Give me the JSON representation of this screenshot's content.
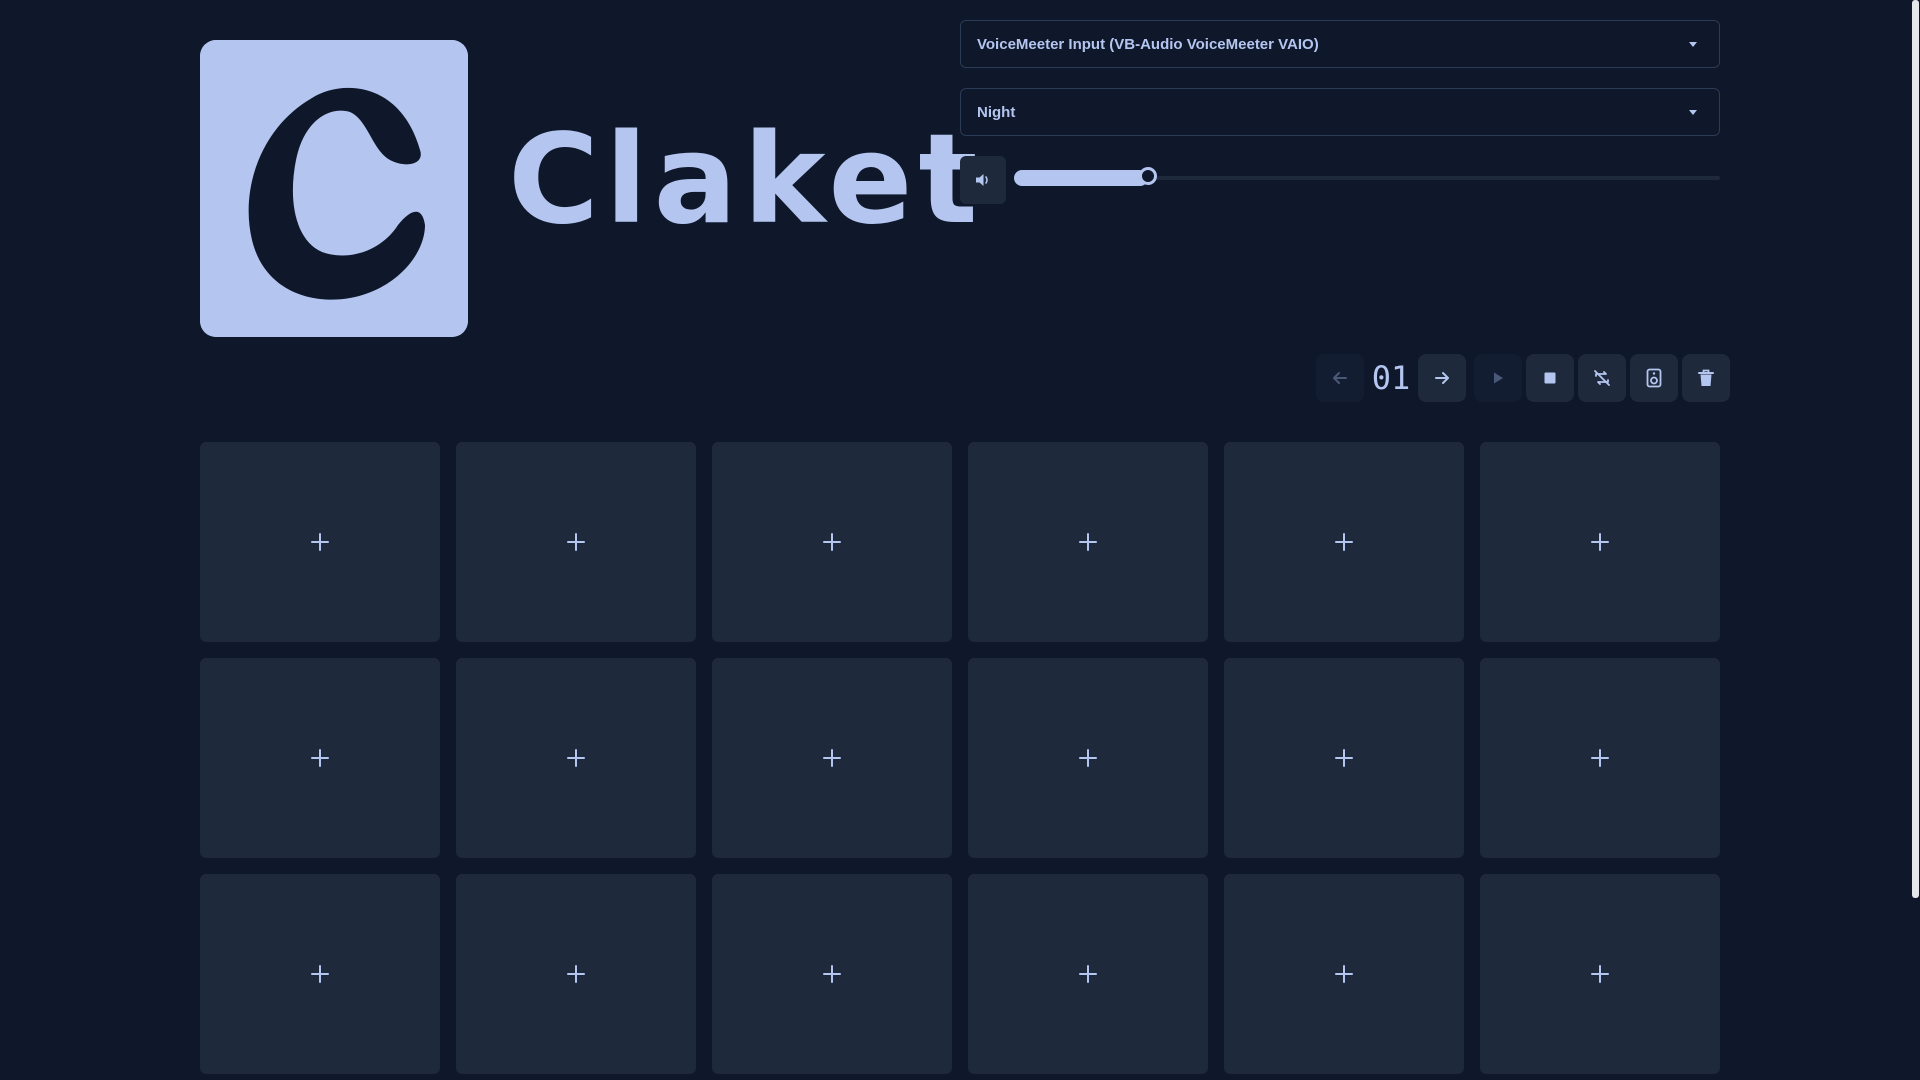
{
  "app": {
    "name": "Claket"
  },
  "audio": {
    "device": {
      "selected": "VoiceMeeter Input (VB-Audio VoiceMeeter VAIO)"
    },
    "volume": {
      "level_percent": 19
    }
  },
  "theme": {
    "selected": "Night"
  },
  "toolbar": {
    "page_number": "01",
    "buttons": [
      {
        "name": "prev-page",
        "icon": "arrow-left-icon",
        "enabled": false
      },
      {
        "name": "next-page",
        "icon": "arrow-right-icon",
        "enabled": true
      },
      {
        "name": "play",
        "icon": "play-icon",
        "enabled": false
      },
      {
        "name": "stop",
        "icon": "stop-icon",
        "enabled": true
      },
      {
        "name": "loop",
        "icon": "loop-off-icon",
        "enabled": true
      },
      {
        "name": "speaker",
        "icon": "speaker-icon",
        "enabled": true
      },
      {
        "name": "delete",
        "icon": "trash-icon",
        "enabled": true
      }
    ]
  },
  "pads": {
    "rows": 3,
    "columns": 6,
    "add_icon": "plus-icon"
  },
  "colors": {
    "background": "#0f172a",
    "surface": "#1e293b",
    "accent": "#b4c6f0",
    "border": "#2b3a55"
  }
}
